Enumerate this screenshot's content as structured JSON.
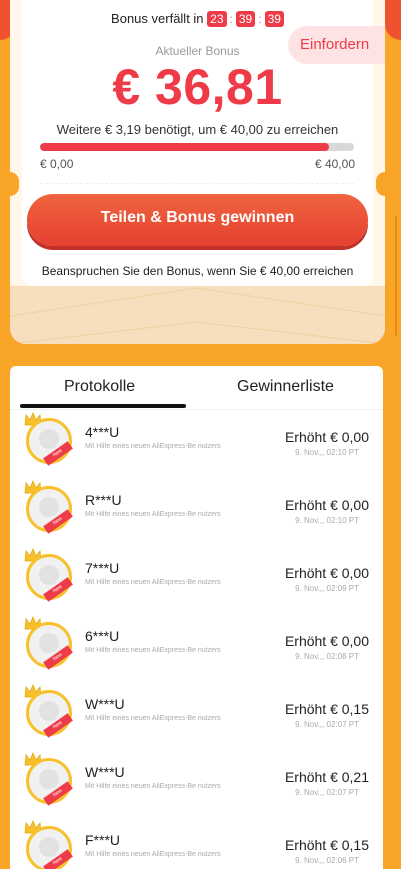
{
  "timer": {
    "label": "Bonus verfällt in",
    "hours": "23",
    "minutes": "39",
    "seconds": "39"
  },
  "claim_button_label": "Einfordern",
  "bonus": {
    "label": "Aktueller Bonus",
    "value": "€ 36,81",
    "needed_text": "Weitere € 3,19 benötigt, um € 40,00 zu erreichen",
    "progress_fraction": 0.92,
    "range_min": "€ 0,00",
    "range_max": "€ 40,00"
  },
  "share_button_label": "Teilen & Bonus gewinnen",
  "claim_note": "Beanspruchen Sie den Bonus, wenn Sie € 40,00 erreichen",
  "tabs": [
    {
      "label": "Protokolle",
      "active": true
    },
    {
      "label": "Gewinnerliste",
      "active": false
    }
  ],
  "colors": {
    "accent_red": "#ee3b47",
    "background_orange": "#f9a528",
    "button_orange": "#e5412f"
  },
  "records": [
    {
      "name": "4***U",
      "sub": "Mit Hilfe eines neuen AliExpress-Be nutzers",
      "amount": "Erhöht € 0,00",
      "time": "9. Nov.,, 02:10 PT"
    },
    {
      "name": "R***U",
      "sub": "Mit Hilfe eines neuen AliExpress-Be nutzers",
      "amount": "Erhöht € 0,00",
      "time": "9. Nov.,, 02:10 PT"
    },
    {
      "name": "7***U",
      "sub": "Mit Hilfe eines neuen AliExpress-Be nutzers",
      "amount": "Erhöht € 0,00",
      "time": "9. Nov.,, 02:09 PT"
    },
    {
      "name": "6***U",
      "sub": "Mit Hilfe eines neuen AliExpress-Be nutzers",
      "amount": "Erhöht € 0,00",
      "time": "9. Nov.,, 02:08 PT"
    },
    {
      "name": "W***U",
      "sub": "Mit Hilfe eines neuen AliExpress-Be nutzers",
      "amount": "Erhöht € 0,15",
      "time": "9. Nov.,, 02:07 PT"
    },
    {
      "name": "W***U",
      "sub": "Mit Hilfe eines neuen AliExpress-Be nutzers",
      "amount": "Erhöht € 0,21",
      "time": "9. Nov.,, 02:07 PT"
    },
    {
      "name": "F***U",
      "sub": "Mit Hilfe eines neuen AliExpress-Be nutzers",
      "amount": "Erhöht € 0,15",
      "time": "9. Nov.,, 02:06 PT"
    }
  ],
  "avatar_badge_label": "New"
}
